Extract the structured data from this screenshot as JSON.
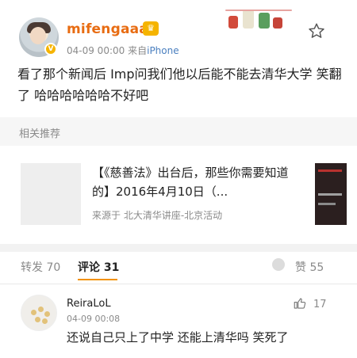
{
  "post": {
    "username": "mifengaaa",
    "time": "04-09 00:00",
    "source_prefix": "来自",
    "source": "iPhone",
    "text": "看了那个新闻后 Imp问我们他以后能不能去清华大学 笑翻了 哈哈哈哈哈哈不好吧"
  },
  "recommend": {
    "section_title": "相关推荐",
    "title": "【《慈善法》出台后，那些你需要知道的】2016年4月10日（...",
    "source": "来源于 北大清华讲座-北京活动"
  },
  "tabs": {
    "repost": "转发 70",
    "comment": "评论 31",
    "like": "赞 55"
  },
  "comment": {
    "name": "ReiraLoL",
    "time": "04-09 00:08",
    "likes": "17",
    "text": "还说自己只上了中学 还能上清华吗 笑死了"
  },
  "colors": {
    "username": "#e86c12",
    "source_link": "#4a7fbf",
    "tab_underline": "#f29100"
  }
}
